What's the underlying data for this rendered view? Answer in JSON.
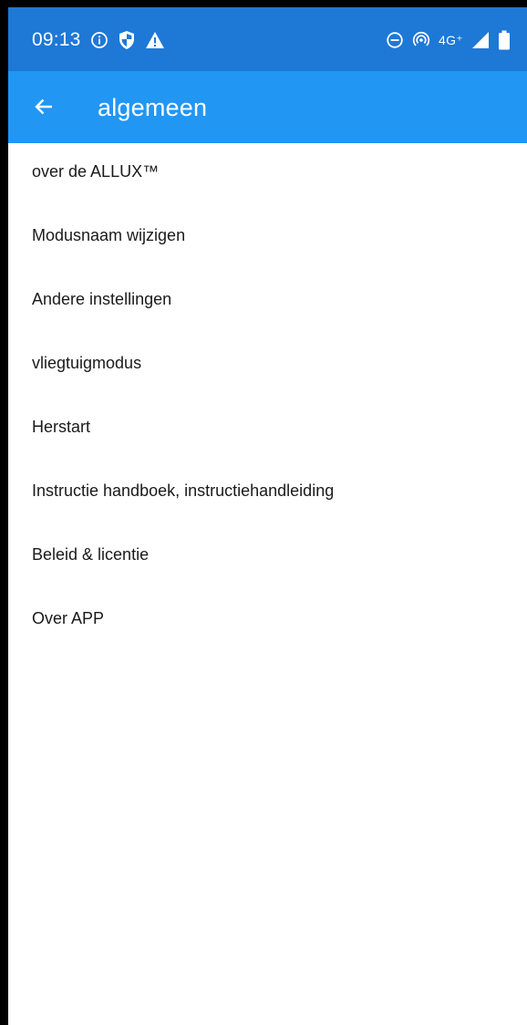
{
  "status_bar": {
    "time": "09:13",
    "network_label": "4G⁺",
    "left_icons": [
      "info-icon",
      "shield-icon",
      "warning-icon"
    ],
    "right_icons": [
      "do-not-disturb-icon",
      "hotspot-icon",
      "signal-icon",
      "battery-icon"
    ]
  },
  "app_bar": {
    "title": "algemeen",
    "back_icon": "back-arrow-icon"
  },
  "menu": {
    "items": [
      {
        "label": "over de ALLUX™"
      },
      {
        "label": "Modusnaam wijzigen"
      },
      {
        "label": "Andere instellingen"
      },
      {
        "label": "vliegtuigmodus"
      },
      {
        "label": "Herstart"
      },
      {
        "label": "Instructie handboek, instructiehandleiding"
      },
      {
        "label": "Beleid & licentie"
      },
      {
        "label": "Over APP"
      }
    ]
  },
  "colors": {
    "status_bar": "#1e78d6",
    "app_bar": "#2196f3",
    "background": "#ffffff",
    "text": "#1a1a1a"
  }
}
